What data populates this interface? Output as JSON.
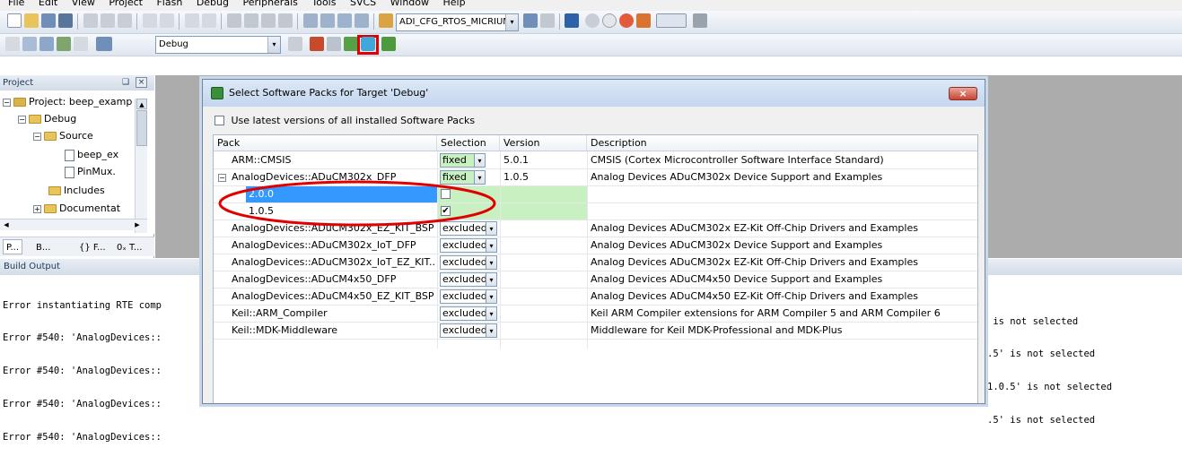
{
  "menu": [
    "File",
    "Edit",
    "View",
    "Project",
    "Flash",
    "Debug",
    "Peripherals",
    "Tools",
    "SVCS",
    "Window",
    "Help"
  ],
  "toolbar": {
    "config_combo": "ADI_CFG_RTOS_MICRIUM",
    "target_combo": "Debug",
    "highlight_color": "#e00000"
  },
  "project_panel": {
    "header": "Project",
    "pin": "❑",
    "close": "×",
    "tree": [
      {
        "label": "Project: beep_examp",
        "expander": "−"
      },
      {
        "label": "Debug",
        "expander": "−"
      },
      {
        "label": "Source",
        "expander": "−"
      },
      {
        "label": "beep_ex"
      },
      {
        "label": "PinMux."
      },
      {
        "label": "Includes"
      },
      {
        "label": "Documentat",
        "expander": "+"
      }
    ],
    "tabs": [
      "P...",
      "B...",
      "{} F...",
      "0ₓ T..."
    ]
  },
  "build_output": {
    "header": "Build Output",
    "left_lines": [
      "Error instantiating RTE comp",
      "Error #540: 'AnalogDevices::",
      "Error #540: 'AnalogDevices::",
      "Error #540: 'AnalogDevices::",
      "Error #540: 'AnalogDevices::"
    ],
    "right_lines": [
      " is not selected",
      ".5' is not selected",
      "1.0.5' is not selected",
      ".5' is not selected"
    ]
  },
  "dialog": {
    "title": "Select Software Packs for Target 'Debug'",
    "close_label": "×",
    "use_latest_label": "Use latest versions of all installed Software Packs",
    "columns": [
      "Pack",
      "Selection",
      "Version",
      "Description"
    ],
    "rows": [
      {
        "pack": "ARM::CMSIS",
        "selection": "fixed",
        "version": "5.0.1",
        "description": "CMSIS (Cortex Microcontroller Software Interface Standard)"
      },
      {
        "pack": "AnalogDevices::ADuCM302x_DFP",
        "selection": "fixed",
        "version": "1.0.5",
        "description": "Analog Devices ADuCM302x Device Support and Examples",
        "expander": "−"
      },
      {
        "pack": "2.0.0",
        "sub": true,
        "checked": false
      },
      {
        "pack": "1.0.5",
        "sub": true,
        "checked": true
      },
      {
        "pack": "AnalogDevices::ADuCM302x_EZ_KIT_BSP",
        "selection": "excluded",
        "version": "",
        "description": "Analog Devices ADuCM302x EZ-Kit Off-Chip Drivers and Examples"
      },
      {
        "pack": "AnalogDevices::ADuCM302x_IoT_DFP",
        "selection": "excluded",
        "version": "",
        "description": "Analog Devices ADuCM302x Device Support and Examples"
      },
      {
        "pack": "AnalogDevices::ADuCM302x_IoT_EZ_KIT...",
        "selection": "excluded",
        "version": "",
        "description": "Analog Devices ADuCM302x EZ-Kit Off-Chip Drivers and Examples"
      },
      {
        "pack": "AnalogDevices::ADuCM4x50_DFP",
        "selection": "excluded",
        "version": "",
        "description": "Analog Devices ADuCM4x50 Device Support and Examples"
      },
      {
        "pack": "AnalogDevices::ADuCM4x50_EZ_KIT_BSP",
        "selection": "excluded",
        "version": "",
        "description": "Analog Devices ADuCM4x50 EZ-Kit Off-Chip Drivers and Examples"
      },
      {
        "pack": "Keil::ARM_Compiler",
        "selection": "excluded",
        "version": "",
        "description": "Keil ARM Compiler extensions for ARM Compiler 5 and ARM Compiler 6"
      },
      {
        "pack": "Keil::MDK-Middleware",
        "selection": "excluded",
        "version": "",
        "description": "Middleware for Keil MDK-Professional and MDK-Plus"
      }
    ],
    "annotation_color": "#e00000",
    "check_mark": "✔",
    "dropdown_arrow": "▾"
  }
}
